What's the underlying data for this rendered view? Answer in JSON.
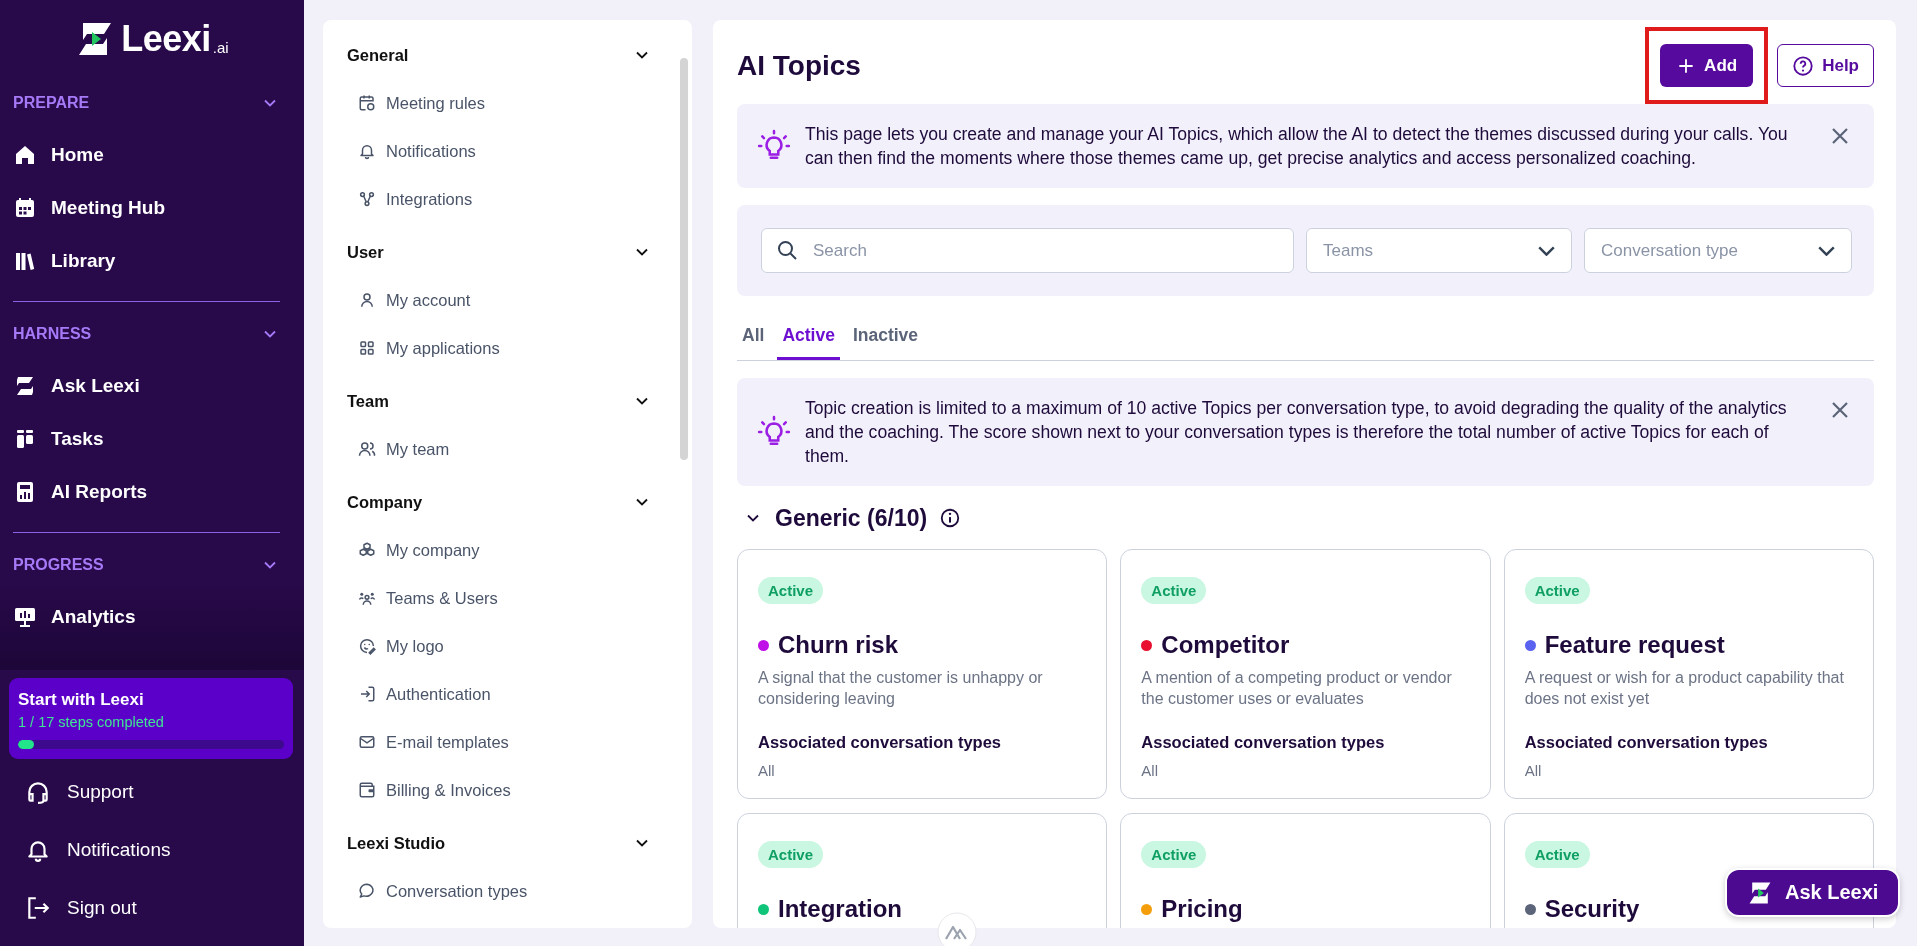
{
  "sidebar": {
    "logo": {
      "name": "Leexi",
      "suffix": ".ai"
    },
    "sections": [
      {
        "title": "PREPARE",
        "expanded": true,
        "items": [
          {
            "label": "Home"
          },
          {
            "label": "Meeting Hub"
          },
          {
            "label": "Library"
          }
        ]
      },
      {
        "title": "HARNESS",
        "expanded": true,
        "items": [
          {
            "label": "Ask Leexi"
          },
          {
            "label": "Tasks"
          },
          {
            "label": "AI Reports"
          }
        ]
      },
      {
        "title": "PROGRESS",
        "expanded": true,
        "items": [
          {
            "label": "Analytics"
          }
        ]
      }
    ],
    "onboarding": {
      "title": "Start with Leexi",
      "progress_text": "1 / 17 steps completed",
      "level": 0.06
    },
    "footer_items": [
      {
        "label": "Support"
      },
      {
        "label": "Notifications"
      },
      {
        "label": "Sign out"
      }
    ]
  },
  "settings_nav": {
    "sections": [
      {
        "title": "General",
        "expanded": true,
        "items": [
          {
            "label": "Meeting rules"
          },
          {
            "label": "Notifications"
          },
          {
            "label": "Integrations"
          }
        ]
      },
      {
        "title": "User",
        "expanded": true,
        "items": [
          {
            "label": "My account"
          },
          {
            "label": "My applications"
          }
        ]
      },
      {
        "title": "Team",
        "expanded": true,
        "items": [
          {
            "label": "My team"
          }
        ]
      },
      {
        "title": "Company",
        "expanded": true,
        "items": [
          {
            "label": "My company"
          },
          {
            "label": "Teams & Users"
          },
          {
            "label": "My logo"
          },
          {
            "label": "Authentication"
          },
          {
            "label": "E-mail templates"
          },
          {
            "label": "Billing & Invoices"
          }
        ]
      },
      {
        "title": "Leexi Studio",
        "expanded": true,
        "items": [
          {
            "label": "Conversation types"
          }
        ]
      }
    ]
  },
  "main": {
    "title": "AI Topics",
    "add_button": {
      "label": "Add",
      "highlighted": true
    },
    "help_button": {
      "label": "Help"
    },
    "intro_banner": {
      "text": "This page lets you create and manage your AI Topics, which allow the AI to detect the themes discussed during your calls. You can then find the moments where those themes came up, get precise analytics and access personalized coaching."
    },
    "filters": {
      "search": {
        "placeholder": "Search"
      },
      "dropdowns": [
        {
          "placeholder": "Teams"
        },
        {
          "placeholder": "Conversation type"
        }
      ]
    },
    "tabs": [
      {
        "label": "All",
        "selected": false
      },
      {
        "label": "Active",
        "selected": true
      },
      {
        "label": "Inactive",
        "selected": false
      }
    ],
    "limit_banner": {
      "text": "Topic creation is limited to a maximum of 10 active Topics per conversation type, to avoid degrading the quality of the analytics and the coaching. The score shown next to your conversation types is therefore the total number of active Topics for each of them."
    },
    "group": {
      "title": "Generic (6/10)",
      "expanded": true,
      "cards": [
        {
          "status": "Active",
          "active": true,
          "name": "Churn risk",
          "color": "#c010e8",
          "description": "A signal that the customer is unhappy or considering leaving",
          "types_label": "Associated conversation types",
          "types": "All"
        },
        {
          "status": "Active",
          "active": true,
          "name": "Competitor",
          "color": "#e8102e",
          "description": "A mention of a competing product or vendor the customer uses or evaluates",
          "types_label": "Associated conversation types",
          "types": "All"
        },
        {
          "status": "Active",
          "active": true,
          "name": "Feature request",
          "color": "#5a63f0",
          "description": "A request or wish for a product capability that does not exist yet",
          "types_label": "Associated conversation types",
          "types": "All"
        },
        {
          "status": "Active",
          "active": true,
          "name": "Integration",
          "color": "#10c47a"
        },
        {
          "status": "Active",
          "active": true,
          "name": "Pricing",
          "color": "#f59e0b"
        },
        {
          "status": "Active",
          "active": true,
          "name": "Security",
          "color": "#5b6478"
        }
      ]
    }
  },
  "ask_button": {
    "label": "Ask Leexi"
  }
}
